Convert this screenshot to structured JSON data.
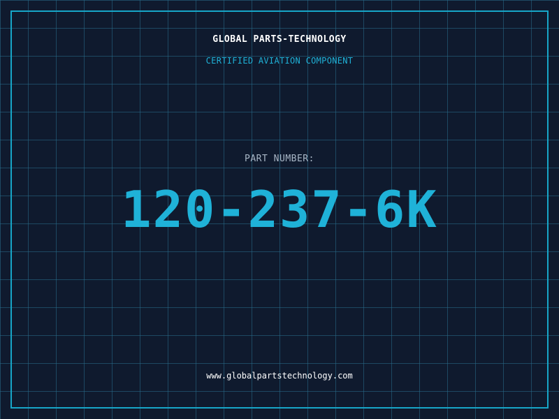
{
  "header": {
    "brand": "GLOBAL PARTS-TECHNOLOGY",
    "tagline": "CERTIFIED AVIATION COMPONENT"
  },
  "part": {
    "label": "PART NUMBER:",
    "number": "120-237-6K"
  },
  "footer": {
    "website": "www.globalpartstechnology.com"
  },
  "colors": {
    "background": "#0f1a2e",
    "accent": "#1fb2d8",
    "border": "#17a6c8",
    "label": "#a8b6c6"
  }
}
